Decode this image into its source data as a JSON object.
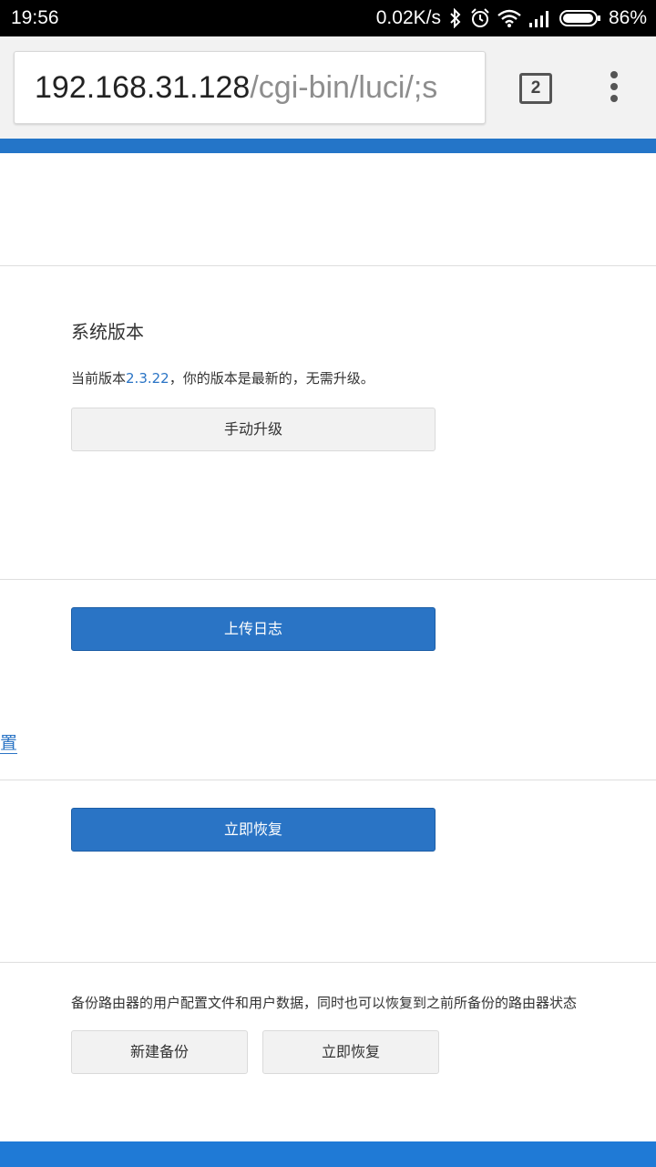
{
  "status_bar": {
    "time": "19:56",
    "speed": "0.02K/s",
    "battery": "86%"
  },
  "browser": {
    "url_host": "192.168.31.128",
    "url_path": "/cgi-bin/luci/;s",
    "tab_count": "2"
  },
  "version_section": {
    "title": "系统版本",
    "current_prefix": "当前版本",
    "version": "2.3.22",
    "status_suffix": "，你的版本是最新的，无需升级。",
    "manual_upgrade": "手动升级"
  },
  "log_section": {
    "upload_log": "上传日志"
  },
  "side_link": "置",
  "restore_section": {
    "restore_now": "立即恢复"
  },
  "backup_section": {
    "description": "备份路由器的用户配置文件和用户数据，同时也可以恢复到之前所备份的路由器状态",
    "new_backup": "新建备份",
    "restore_now": "立即恢复"
  },
  "colors": {
    "accent": "#2475c8",
    "button_blue": "#2a74c5"
  }
}
